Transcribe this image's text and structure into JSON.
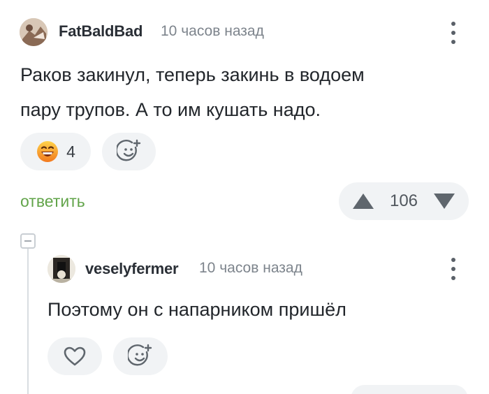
{
  "comment": {
    "username": "FatBaldBad",
    "time": "10 часов назад",
    "text_line1": "Раков закинул, теперь закинь в водоем",
    "text_line2": "пару трупов. А то им кушать надо.",
    "reaction_count": "4",
    "reply_label": "ответить",
    "rating": "106"
  },
  "reply": {
    "username": "veselyfermer",
    "time": "10 часов назад",
    "text": "Поэтому он с напарником пришёл"
  },
  "colors": {
    "accent_green": "#62a44a",
    "pill_bg": "#f1f3f5",
    "icon_gray": "#5f666d"
  }
}
